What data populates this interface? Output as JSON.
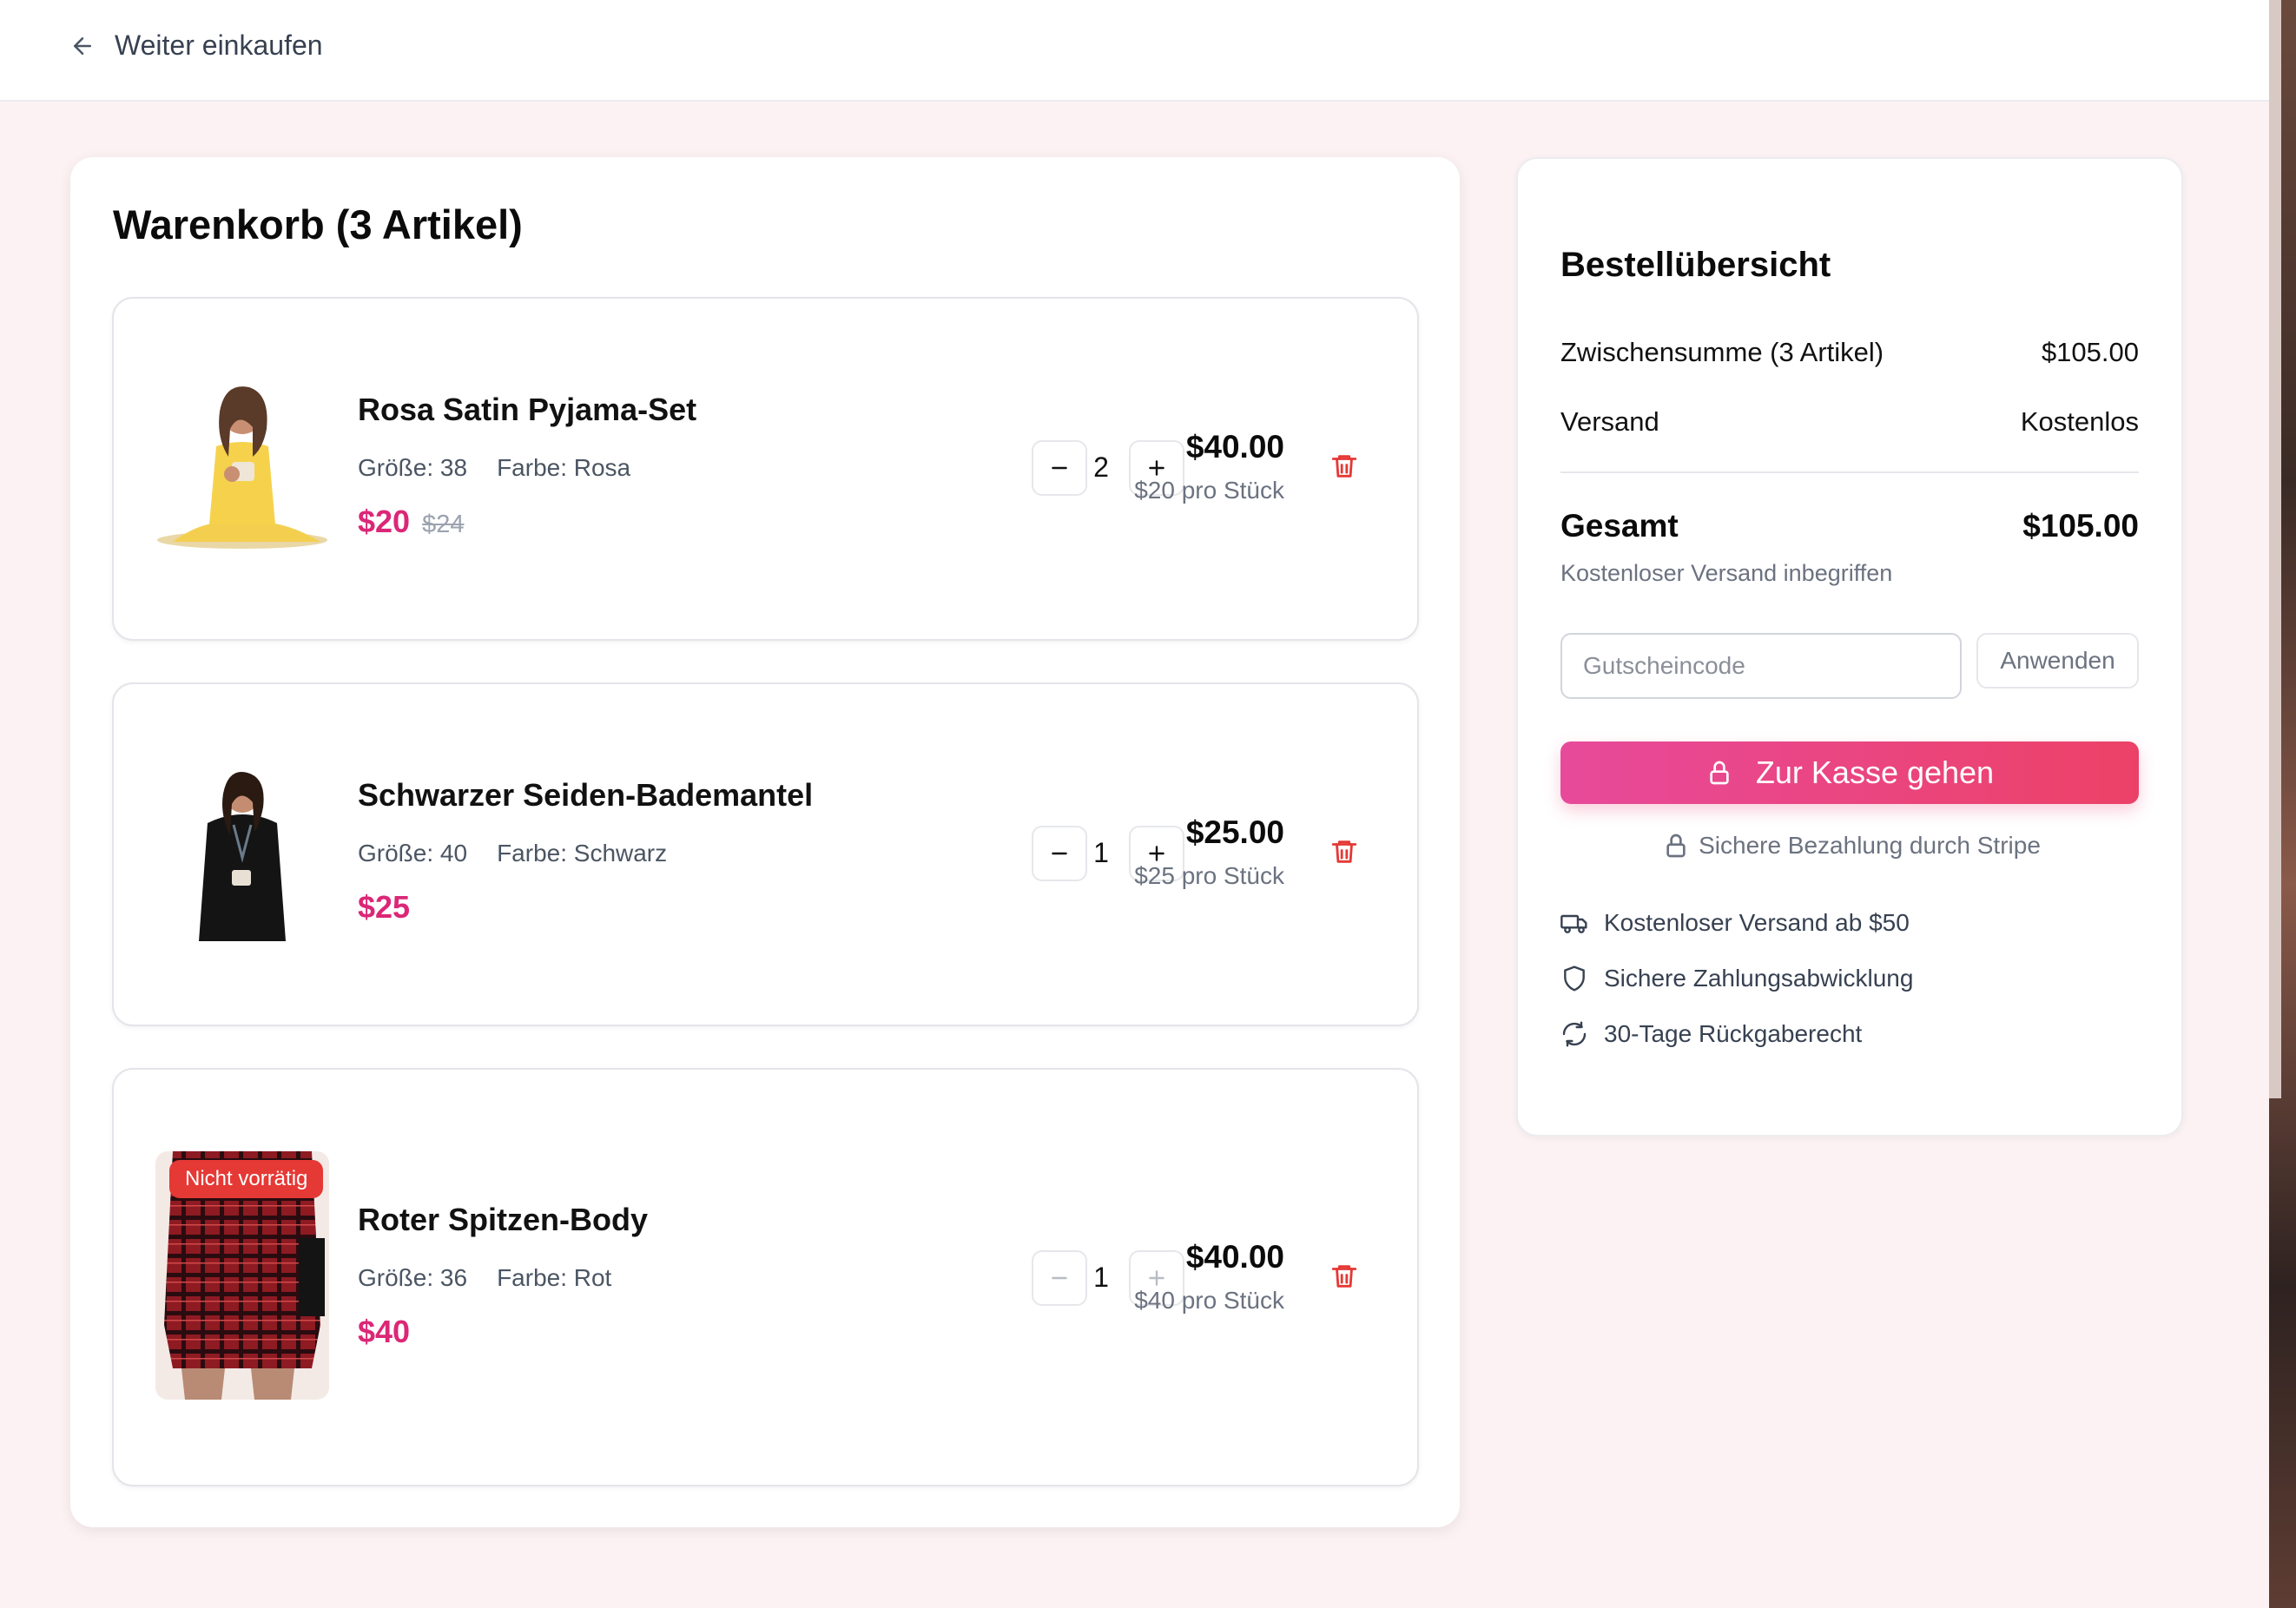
{
  "header": {
    "back_label": "Weiter einkaufen"
  },
  "cart": {
    "title": "Warenkorb (3 Artikel)",
    "items": [
      {
        "name": "Rosa Satin Pyjama-Set",
        "size": "Größe: 38",
        "color": "Farbe: Rosa",
        "price": "$20",
        "old_price": "$24",
        "quantity": "2",
        "line_total": "$40.00",
        "unit_price": "$20 pro Stück",
        "badge": ""
      },
      {
        "name": "Schwarzer Seiden-Bademantel",
        "size": "Größe: 40",
        "color": "Farbe: Schwarz",
        "price": "$25",
        "old_price": "",
        "quantity": "1",
        "line_total": "$25.00",
        "unit_price": "$25 pro Stück",
        "badge": ""
      },
      {
        "name": "Roter Spitzen-Body",
        "size": "Größe: 36",
        "color": "Farbe: Rot",
        "price": "$40",
        "old_price": "",
        "quantity": "1",
        "line_total": "$40.00",
        "unit_price": "$40 pro Stück",
        "badge": "Nicht vorrätig"
      }
    ]
  },
  "summary": {
    "title": "Bestellübersicht",
    "subtotal_label": "Zwischensumme (3 Artikel)",
    "subtotal_value": "$105.00",
    "shipping_label": "Versand",
    "shipping_value": "Kostenlos",
    "total_label": "Gesamt",
    "total_value": "$105.00",
    "shipping_note": "Kostenloser Versand inbegriffen",
    "coupon_placeholder": "Gutscheincode",
    "apply_label": "Anwenden",
    "checkout_label": "Zur Kasse gehen",
    "secure_note": "Sichere Bezahlung durch Stripe",
    "features": [
      "Kostenloser Versand ab $50",
      "Sichere Zahlungsabwicklung",
      "30-Tage Rückgaberecht"
    ]
  },
  "colors": {
    "accent": "#db2777",
    "checkout_gradient_start": "#e84a9b",
    "checkout_gradient_end": "#ec4167",
    "badge": "#e53935",
    "trash": "#e53935",
    "page_bg": "#fcf2f4"
  },
  "icons": {
    "back": "arrow-left-icon",
    "minus": "minus-icon",
    "plus": "plus-icon",
    "delete": "trash-icon",
    "lock": "lock-icon",
    "truck": "truck-icon",
    "shield": "shield-icon",
    "refresh": "refresh-icon"
  }
}
